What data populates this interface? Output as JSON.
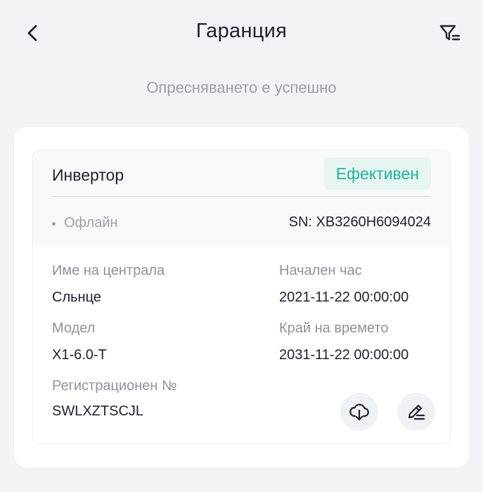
{
  "header": {
    "title": "Гаранция"
  },
  "refresh_message": "Опресняването е успешно",
  "device": {
    "name": "Инвертор",
    "status": "Ефективен",
    "connection": "Офлайн",
    "serial": "SN: XB3260H6094024",
    "fields": {
      "plant_label": "Име на централа",
      "plant_value": "Сльнце",
      "start_label": "Начален час",
      "start_value": "2021-11-22 00:00:00",
      "model_label": "Модел",
      "model_value": "X1-6.0-T",
      "end_label": "Край на времето",
      "end_value": "2031-11-22 00:00:00",
      "reg_label": "Регистрационен №",
      "reg_value": "SWLXZTSCJL"
    }
  },
  "colors": {
    "accent": "#22b39b",
    "badge_bg": "#e6f5f2",
    "text_primary": "#1d2230",
    "text_secondary": "#8e929c",
    "page_bg": "#f2f3f6"
  },
  "icons": {
    "back": "chevron-left-icon",
    "filter": "filter-list-icon",
    "download": "cloud-download-icon",
    "edit": "pencil-edit-icon"
  }
}
